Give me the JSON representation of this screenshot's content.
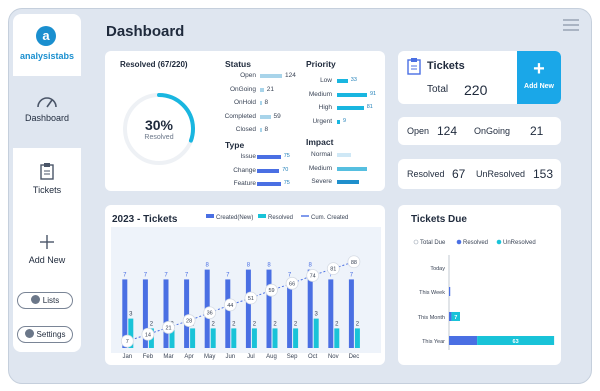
{
  "app": {
    "logo_letter": "a",
    "logo_text": "analysistabs",
    "page_title": "Dashboard"
  },
  "sidebar": {
    "items": [
      {
        "label": "Dashboard",
        "icon": "gauge-icon"
      },
      {
        "label": "Tickets",
        "icon": "clipboard-icon"
      },
      {
        "label": "Add New",
        "icon": "plus-icon"
      }
    ],
    "pills": [
      {
        "label": "Lists"
      },
      {
        "label": "Settings"
      }
    ]
  },
  "resolved": {
    "title": "Resolved (67/220)",
    "percent": "30%",
    "caption": "Resolved",
    "fraction": 0.305
  },
  "status": {
    "title": "Status",
    "rows": [
      {
        "label": "Open",
        "value": "124",
        "frac": 1.0
      },
      {
        "label": "OnGoing",
        "value": "21",
        "frac": 0.17
      },
      {
        "label": "OnHold",
        "value": "8",
        "frac": 0.07
      },
      {
        "label": "Completed",
        "value": "59",
        "frac": 0.48
      },
      {
        "label": "Closed",
        "value": "8",
        "frac": 0.07
      }
    ]
  },
  "priority": {
    "title": "Priority",
    "rows": [
      {
        "label": "Low",
        "value": "33",
        "frac": 0.36
      },
      {
        "label": "Medium",
        "value": "91",
        "frac": 1.0
      },
      {
        "label": "High",
        "value": "81",
        "frac": 0.89
      },
      {
        "label": "Urgent",
        "value": "9",
        "frac": 0.1
      }
    ]
  },
  "type": {
    "title": "Type",
    "rows": [
      {
        "label": "Issue",
        "value": "75",
        "frac": 0.95
      },
      {
        "label": "Change",
        "value": "70",
        "frac": 0.89
      },
      {
        "label": "Feature",
        "value": "75",
        "frac": 0.95
      }
    ]
  },
  "impact": {
    "title": "Impact",
    "rows": [
      {
        "label": "Normal",
        "frac": 0.45,
        "color": "#cfe8f6"
      },
      {
        "label": "Medium",
        "frac": 1.0,
        "color": "#56bfe0"
      },
      {
        "label": "Severe",
        "frac": 0.72,
        "color": "#1f8fcc"
      }
    ]
  },
  "tickets_card": {
    "title": "Tickets",
    "total_label": "Total",
    "total_value": "220",
    "add_label": "Add New"
  },
  "kpis": [
    {
      "a_label": "Open",
      "a_value": "124",
      "b_label": "OnGoing",
      "b_value": "21"
    },
    {
      "a_label": "Resolved",
      "a_value": "67",
      "b_label": "UnResolved",
      "b_value": "153"
    }
  ],
  "colors": {
    "created": "#4a6fe3",
    "resolved": "#19c3d8",
    "cum": "#4a6fe3",
    "accent": "#1aa7e8",
    "title_bar": "#d9e2ee"
  },
  "chart_data": [
    {
      "type": "bar",
      "title": "2023 -  Tickets",
      "categories": [
        "Jan",
        "Feb",
        "Mar",
        "Apr",
        "May",
        "Jun",
        "Jul",
        "Aug",
        "Sep",
        "Oct",
        "Nov",
        "Dec"
      ],
      "series": [
        {
          "name": "Created(New)",
          "values": [
            7,
            7,
            7,
            7,
            8,
            7,
            8,
            8,
            7,
            8,
            7,
            7
          ]
        },
        {
          "name": "Resolved",
          "values": [
            3,
            2,
            2,
            2,
            2,
            2,
            2,
            2,
            2,
            3,
            2,
            2
          ]
        },
        {
          "name": "Cum. Created",
          "type": "line",
          "values": [
            7,
            14,
            21,
            28,
            36,
            44,
            51,
            59,
            66,
            74,
            81,
            88
          ]
        }
      ],
      "ylim": [
        0,
        10
      ],
      "cum_ylim": [
        0,
        100
      ],
      "legend": "top"
    },
    {
      "type": "bar",
      "orientation": "horizontal",
      "title": "Tickets Due",
      "categories": [
        "Today",
        "This Week",
        "This Month",
        "This Year"
      ],
      "series": [
        {
          "name": "Total Due",
          "values": [
            0,
            0,
            0,
            0
          ]
        },
        {
          "name": "Resolved",
          "values": [
            0,
            1,
            2,
            23
          ]
        },
        {
          "name": "UnResolved",
          "values": [
            0,
            0,
            7,
            63
          ]
        }
      ],
      "xlim": [
        0,
        90
      ],
      "legend": "top"
    }
  ]
}
